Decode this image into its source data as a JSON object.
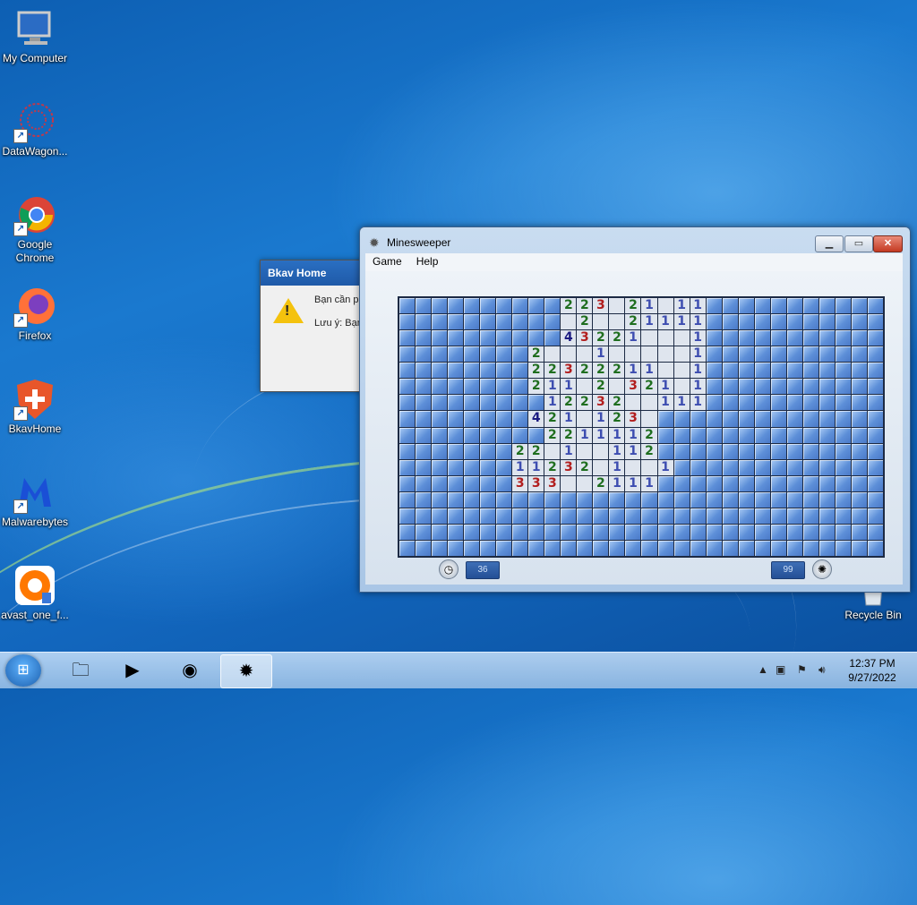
{
  "desktop": {
    "icons": [
      {
        "label": "My Computer"
      },
      {
        "label": "DataWagon..."
      },
      {
        "label": "Google Chrome"
      },
      {
        "label": "Firefox"
      },
      {
        "label": "BkavHome"
      },
      {
        "label": "Malwarebytes"
      },
      {
        "label": "avast_one_f..."
      },
      {
        "label": "Recycle Bin"
      }
    ]
  },
  "dialog": {
    "title": "Bkav Home",
    "line1": "Bạn cần ph",
    "line2": "Lưu ý: Bạn"
  },
  "minesweeper": {
    "title": "Minesweeper",
    "menu": {
      "game": "Game",
      "help": "Help"
    },
    "time": "36",
    "mines_remaining": "99",
    "rows": [
      "..........223.21.11...........",
      "...........2..21111...........",
      "..........43221...1...........",
      "........2...1.....1...........",
      "........22322211..1...........",
      "........211.2.321.1...........",
      ".........12232..111...........",
      "........421.123...............",
      ".........2211112..............",
      ".......22.1..112..............",
      ".......11232.1..1.............",
      ".......333..2111..............",
      "..............................",
      "..............................",
      "..............................",
      ".............................."
    ]
  },
  "taskbar": {
    "clock_time": "12:37 PM",
    "clock_date": "9/27/2022"
  }
}
